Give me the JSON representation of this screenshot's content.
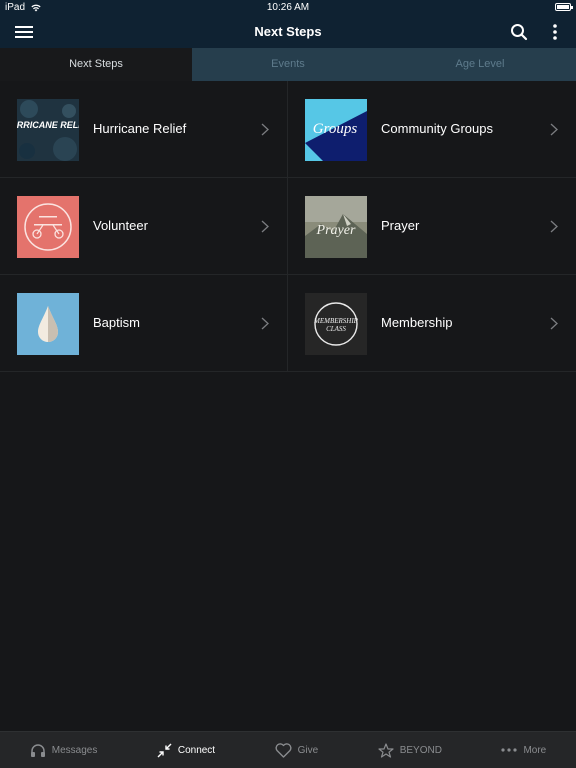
{
  "status": {
    "device": "iPad",
    "time": "10:26 AM"
  },
  "nav": {
    "title": "Next Steps"
  },
  "tabs": [
    {
      "label": "Next Steps",
      "active": true
    },
    {
      "label": "Events",
      "active": false
    },
    {
      "label": "Age Level",
      "active": false
    }
  ],
  "items": [
    {
      "label": "Hurricane Relief",
      "thumb_text": "HURRICANE RELIEF"
    },
    {
      "label": "Community Groups",
      "thumb_text": "Groups"
    },
    {
      "label": "Volunteer"
    },
    {
      "label": "Prayer",
      "thumb_text": "Prayer"
    },
    {
      "label": "Baptism"
    },
    {
      "label": "Membership",
      "thumb_text": "MEMBERSHIP CLASS"
    }
  ],
  "bottom_tabs": [
    {
      "label": "Messages",
      "icon": "headphones-icon",
      "active": false
    },
    {
      "label": "Connect",
      "icon": "connect-arrows-icon",
      "active": true
    },
    {
      "label": "Give",
      "icon": "heart-icon",
      "active": false
    },
    {
      "label": "BEYOND",
      "icon": "star-icon",
      "active": false
    },
    {
      "label": "More",
      "icon": "ellipsis-icon",
      "active": false
    }
  ],
  "colors": {
    "header_bg": "#0f2232",
    "tab_bar_bg": "#263e4d",
    "content_bg": "#161719",
    "bottom_bar_bg": "#252628"
  }
}
